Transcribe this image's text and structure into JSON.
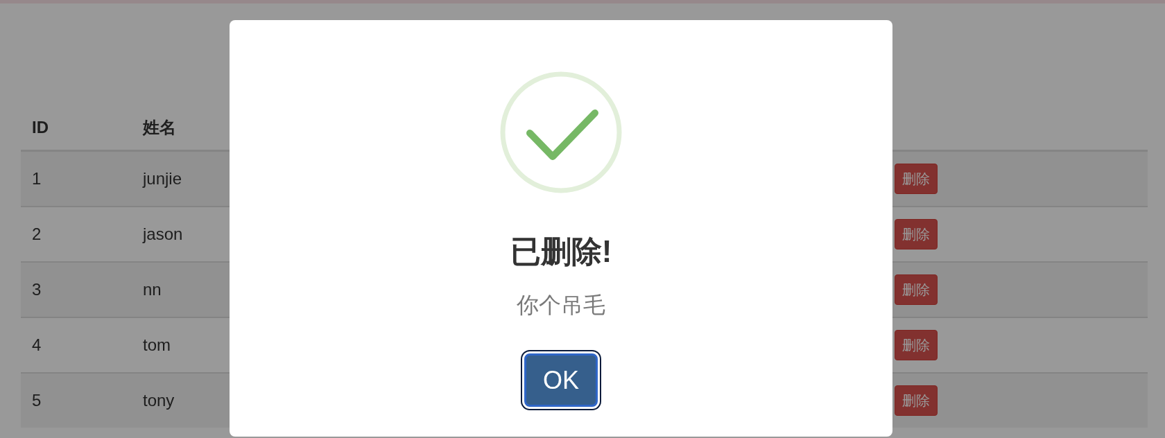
{
  "table": {
    "columns": [
      "ID",
      "姓名"
    ],
    "rows": [
      {
        "id": "1",
        "name": "junjie",
        "action": "删除"
      },
      {
        "id": "2",
        "name": "jason",
        "action": "删除"
      },
      {
        "id": "3",
        "name": "nn",
        "action": "删除"
      },
      {
        "id": "4",
        "name": "tom",
        "action": "删除"
      },
      {
        "id": "5",
        "name": "tony",
        "action": "删除"
      }
    ]
  },
  "dialog": {
    "title": "已删除!",
    "text": "你个吊毛",
    "button": {
      "label": "OK",
      "focused": true
    }
  }
}
